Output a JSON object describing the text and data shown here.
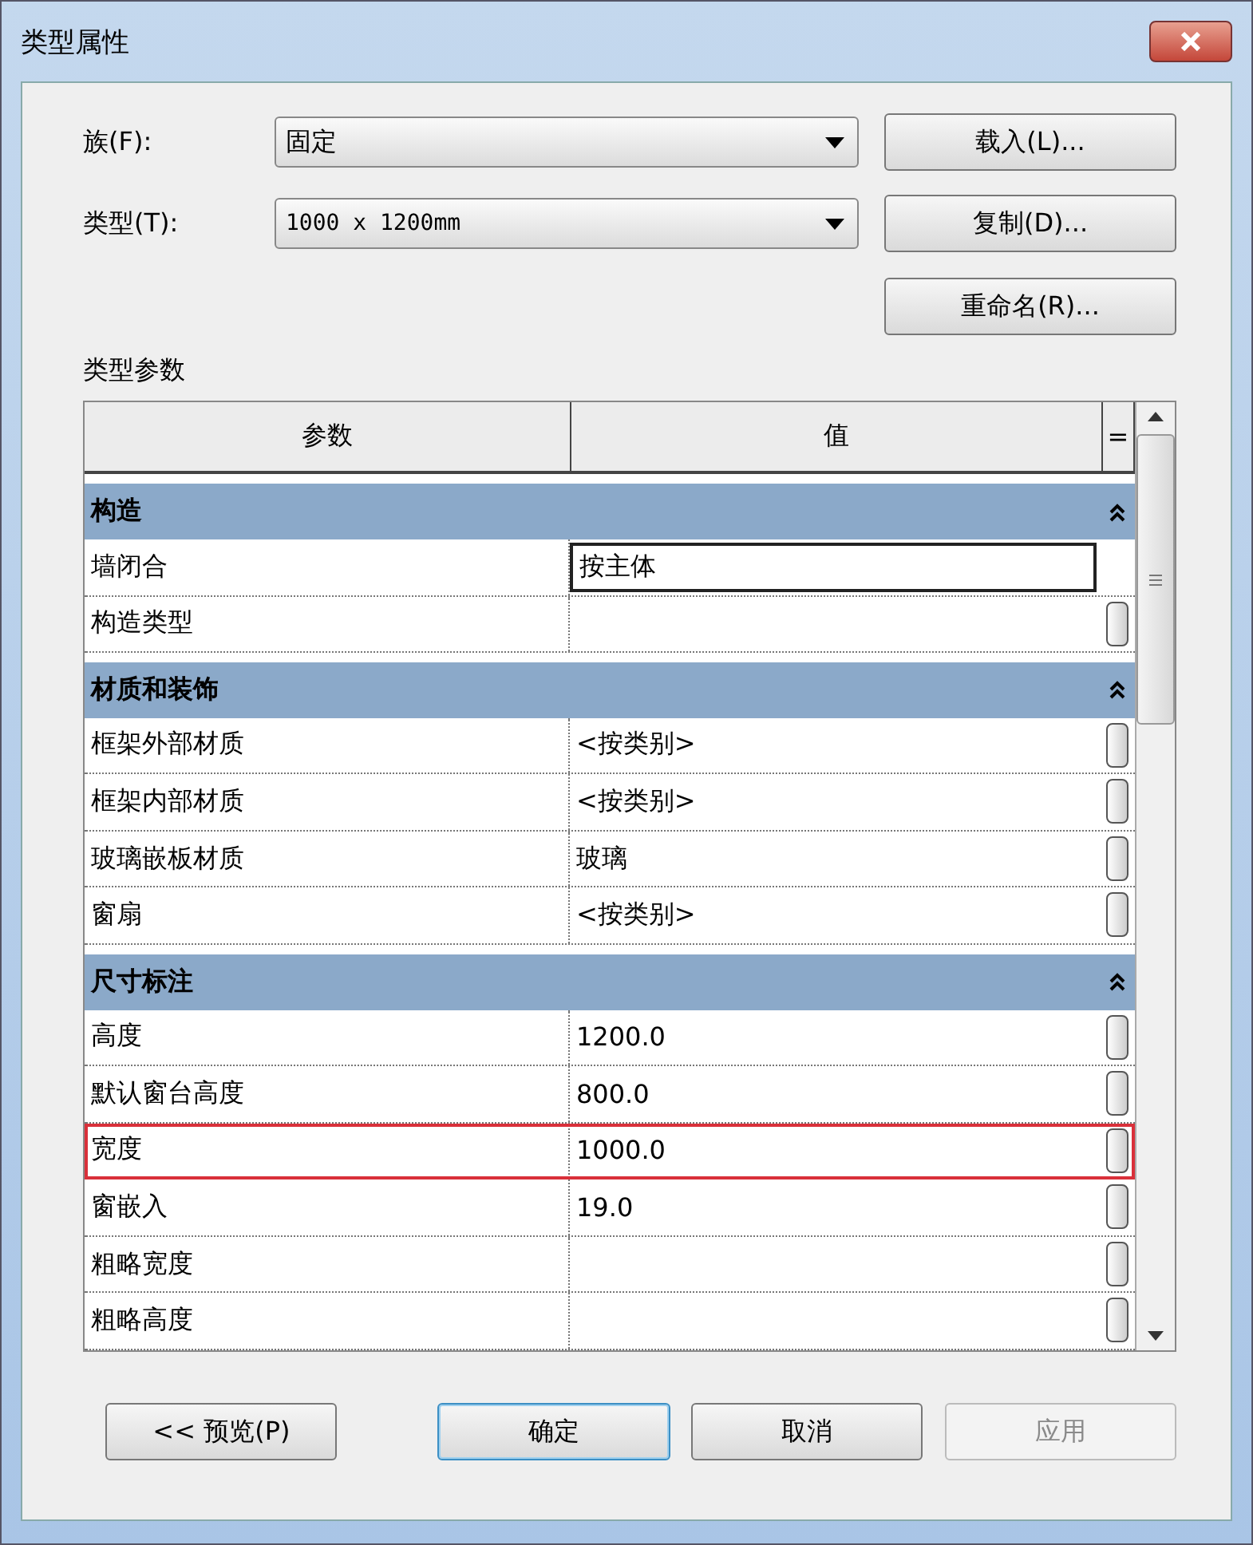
{
  "window": {
    "title": "类型属性"
  },
  "fields": [
    {
      "label": "族(F):",
      "value": "固定",
      "button": "载入(L)..."
    },
    {
      "label": "类型(T):",
      "value": "1000 x 1200mm",
      "button": "复制(D)..."
    }
  ],
  "rename_button": "重命名(R)...",
  "section_label": "类型参数",
  "table": {
    "columns": [
      "参数",
      "值",
      "="
    ],
    "groups": [
      {
        "name": "构造",
        "expanded": true,
        "rows": [
          {
            "name": "墙闭合",
            "value": "按主体",
            "editing": true,
            "highlighted": false
          },
          {
            "name": "构造类型",
            "editing": false,
            "highlighted": false
          }
        ]
      },
      {
        "name": "材质和装饰",
        "expanded": true,
        "rows": [
          {
            "name": "框架外部材质",
            "value": "<按类别>",
            "editing": false,
            "highlighted": false
          },
          {
            "name": "框架内部材质",
            "value": "<按类别>",
            "editing": false,
            "highlighted": false
          },
          {
            "name": "玻璃嵌板材质",
            "value": "玻璃",
            "editing": false,
            "highlighted": false
          },
          {
            "name": "窗扇",
            "value": "<按类别>",
            "editing": false,
            "highlighted": false
          }
        ]
      },
      {
        "name": "尺寸标注",
        "expanded": true,
        "rows": [
          {
            "name": "高度",
            "value": "1200.0",
            "editing": false,
            "highlighted": false
          },
          {
            "name": "默认窗台高度",
            "value": "800.0",
            "editing": false,
            "highlighted": false
          },
          {
            "name": "宽度",
            "value": "1000.0",
            "editing": false,
            "highlighted": true
          },
          {
            "name": "窗嵌入",
            "value": "19.0",
            "editing": false,
            "highlighted": false
          },
          {
            "name": "粗略宽度",
            "editing": false,
            "highlighted": false
          },
          {
            "name": "粗略高度",
            "editing": false,
            "highlighted": false
          }
        ]
      }
    ]
  },
  "buttons": [
    {
      "label": "<< 预览(P)",
      "default": false,
      "disabled": false
    },
    {
      "label": "确定",
      "default": true,
      "disabled": false
    },
    {
      "label": "取消",
      "default": false,
      "disabled": false
    },
    {
      "label": "应用",
      "default": false,
      "disabled": true
    }
  ]
}
